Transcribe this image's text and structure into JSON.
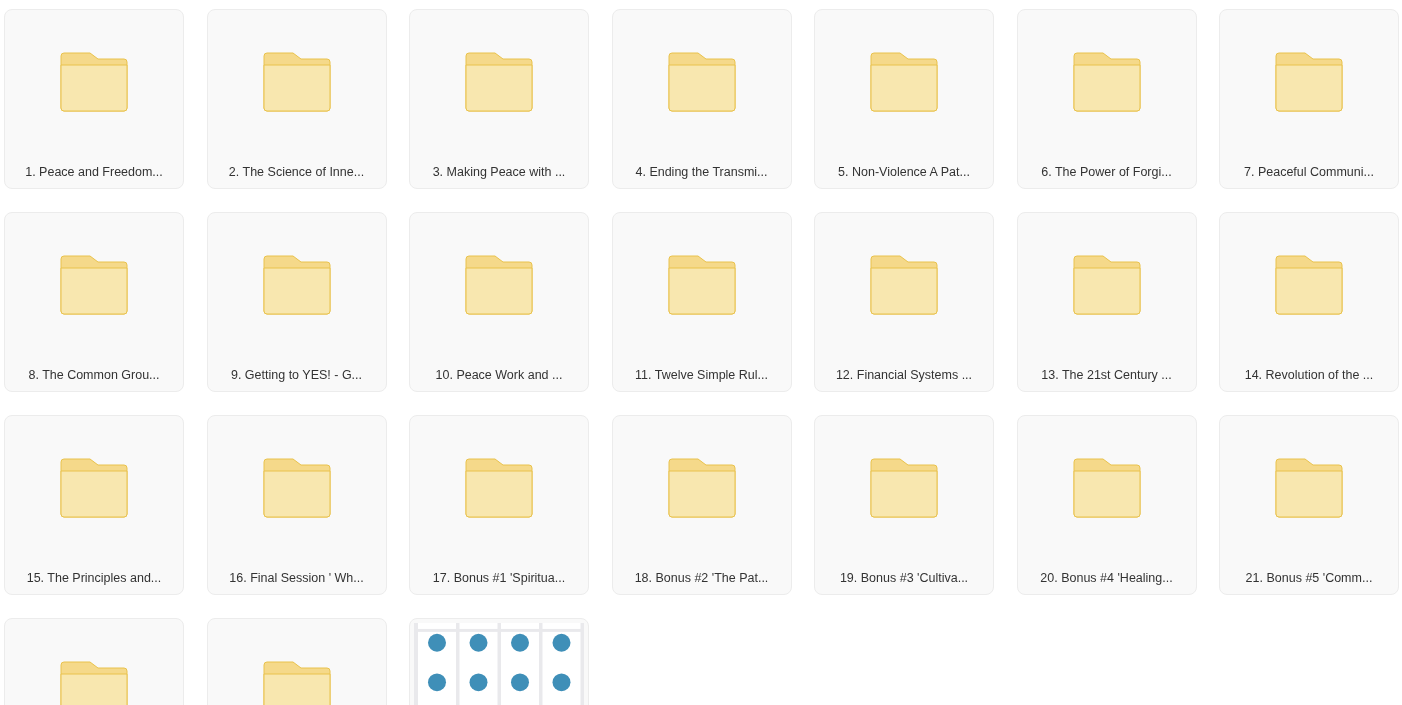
{
  "items": [
    {
      "kind": "folder",
      "label": "1. Peace and Freedom..."
    },
    {
      "kind": "folder",
      "label": "2. The Science of Inne..."
    },
    {
      "kind": "folder",
      "label": "3. Making Peace with ..."
    },
    {
      "kind": "folder",
      "label": "4. Ending the Transmi..."
    },
    {
      "kind": "folder",
      "label": "5. Non-Violence A Pat..."
    },
    {
      "kind": "folder",
      "label": "6. The Power of Forgi..."
    },
    {
      "kind": "folder",
      "label": "7. Peaceful Communi..."
    },
    {
      "kind": "folder",
      "label": "8. The Common Grou..."
    },
    {
      "kind": "folder",
      "label": "9. Getting to YES! - G..."
    },
    {
      "kind": "folder",
      "label": "10. Peace Work and ..."
    },
    {
      "kind": "folder",
      "label": "11. Twelve Simple Rul..."
    },
    {
      "kind": "folder",
      "label": "12. Financial Systems ..."
    },
    {
      "kind": "folder",
      "label": "13. The 21st Century ..."
    },
    {
      "kind": "folder",
      "label": "14. Revolution of the ..."
    },
    {
      "kind": "folder",
      "label": "15. The Principles and..."
    },
    {
      "kind": "folder",
      "label": "16. Final Session ' Wh..."
    },
    {
      "kind": "folder",
      "label": "17. Bonus #1 'Spiritua..."
    },
    {
      "kind": "folder",
      "label": "18. Bonus #2 'The Pat..."
    },
    {
      "kind": "folder",
      "label": "19. Bonus #3 'Cultiva..."
    },
    {
      "kind": "folder",
      "label": "20. Bonus #4 'Healing..."
    },
    {
      "kind": "folder",
      "label": "21. Bonus #5 'Comm..."
    },
    {
      "kind": "folder"
    },
    {
      "kind": "folder"
    },
    {
      "kind": "picture"
    }
  ]
}
